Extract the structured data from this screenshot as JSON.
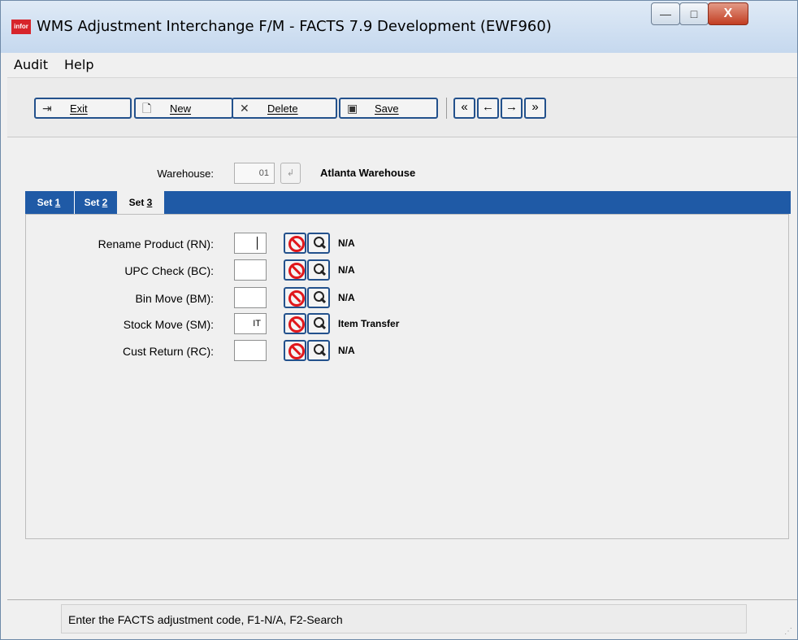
{
  "window": {
    "title": "WMS Adjustment Interchange F/M - FACTS 7.9 Development (EWF960)",
    "app_icon_text": "infor",
    "controls": {
      "minimize": "—",
      "maximize": "□",
      "close": "X"
    }
  },
  "menu": {
    "audit": "Audit",
    "help": "Help"
  },
  "toolbar": {
    "exit": "Exit",
    "new": "New",
    "delete": "Delete",
    "save": "Save",
    "nav": {
      "first": "«",
      "prev": "←",
      "next": "→",
      "last": "»"
    }
  },
  "header": {
    "warehouse_label": "Warehouse:",
    "warehouse_code": "01",
    "warehouse_name": "Atlanta Warehouse"
  },
  "tabs": [
    {
      "prefix": "Set ",
      "key": "1",
      "active": false
    },
    {
      "prefix": "Set ",
      "key": "2",
      "active": false
    },
    {
      "prefix": "Set ",
      "key": "3",
      "active": true
    }
  ],
  "rows": [
    {
      "label": "Rename Product (RN):",
      "value": "",
      "desc": "N/A"
    },
    {
      "label": "UPC Check (BC):",
      "value": "",
      "desc": "N/A"
    },
    {
      "label": "Bin Move (BM):",
      "value": "",
      "desc": "N/A"
    },
    {
      "label": "Stock Move (SM):",
      "value": "IT",
      "desc": "Item Transfer"
    },
    {
      "label": "Cust Return (RC):",
      "value": "",
      "desc": "N/A"
    }
  ],
  "status": {
    "message": "Enter the FACTS adjustment code, F1-N/A, F2-Search"
  },
  "colors": {
    "tab_bar": "#1f5aa6",
    "button_border": "#23518c",
    "no_icon": "#e0171b",
    "close_button": "#c23d22"
  }
}
